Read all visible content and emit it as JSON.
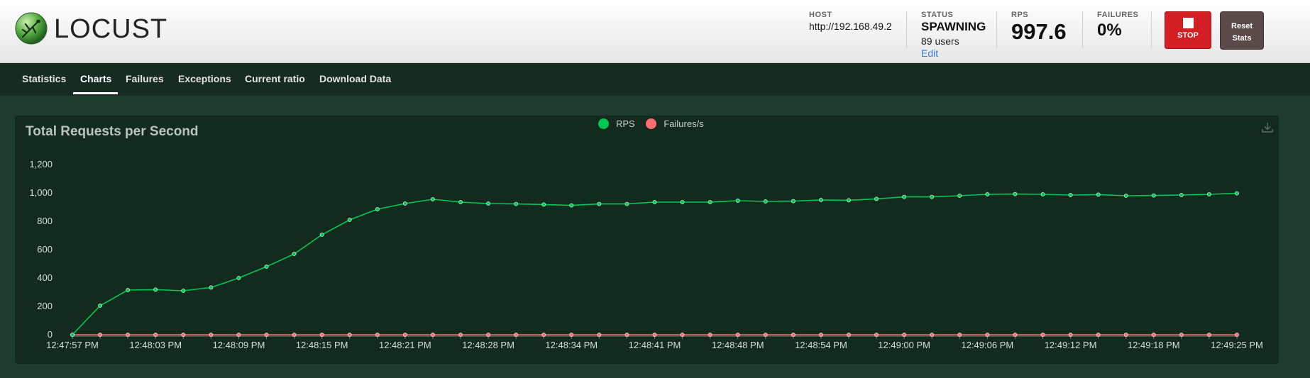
{
  "app": {
    "logo_text": "LOCUST"
  },
  "header": {
    "host_label": "HOST",
    "host_value": "http://192.168.49.2",
    "status_label": "STATUS",
    "status_value": "SPAWNING",
    "users_text": "89 users",
    "edit_label": "Edit",
    "rps_label": "RPS",
    "rps_value": "997.6",
    "failures_label": "FAILURES",
    "failures_value": "0%",
    "stop_label": "STOP",
    "reset_label_1": "Reset",
    "reset_label_2": "Stats"
  },
  "nav": {
    "tabs": [
      "Statistics",
      "Charts",
      "Failures",
      "Exceptions",
      "Current ratio",
      "Download Data"
    ],
    "active": "Charts"
  },
  "colors": {
    "rps": "#00c853",
    "failures": "#ff6d6d",
    "stop": "#d21f23",
    "reset": "#5b4a4a",
    "link": "#3a7fd5"
  },
  "chart_data": {
    "type": "line",
    "title": "Total Requests per Second",
    "xlabel": "",
    "ylabel": "",
    "ylim": [
      0,
      1200
    ],
    "yticks": [
      "0",
      "200",
      "400",
      "600",
      "800",
      "1,000",
      "1,200"
    ],
    "xtick_labels": [
      "12:47:57 PM",
      "12:48:03 PM",
      "12:48:09 PM",
      "12:48:15 PM",
      "12:48:21 PM",
      "12:48:28 PM",
      "12:48:34 PM",
      "12:48:41 PM",
      "12:48:48 PM",
      "12:48:54 PM",
      "12:49:00 PM",
      "12:49:06 PM",
      "12:49:12 PM",
      "12:49:18 PM",
      "12:49:25 PM"
    ],
    "legend_position": "top-center",
    "grid": false,
    "series": [
      {
        "name": "RPS",
        "values": [
          0,
          205,
          315,
          318,
          310,
          333,
          400,
          480,
          570,
          705,
          810,
          885,
          925,
          955,
          935,
          925,
          922,
          918,
          912,
          922,
          922,
          935,
          935,
          935,
          945,
          940,
          942,
          950,
          948,
          958,
          972,
          972,
          980,
          990,
          992,
          990,
          985,
          988,
          980,
          982,
          985,
          990,
          997
        ]
      },
      {
        "name": "Failures/s",
        "values": [
          0,
          0,
          0,
          0,
          0,
          0,
          0,
          0,
          0,
          0,
          0,
          0,
          0,
          0,
          0,
          0,
          0,
          0,
          0,
          0,
          0,
          0,
          0,
          0,
          0,
          0,
          0,
          0,
          0,
          0,
          0,
          0,
          0,
          0,
          0,
          0,
          0,
          0,
          0,
          0,
          0,
          0,
          0
        ]
      }
    ]
  }
}
